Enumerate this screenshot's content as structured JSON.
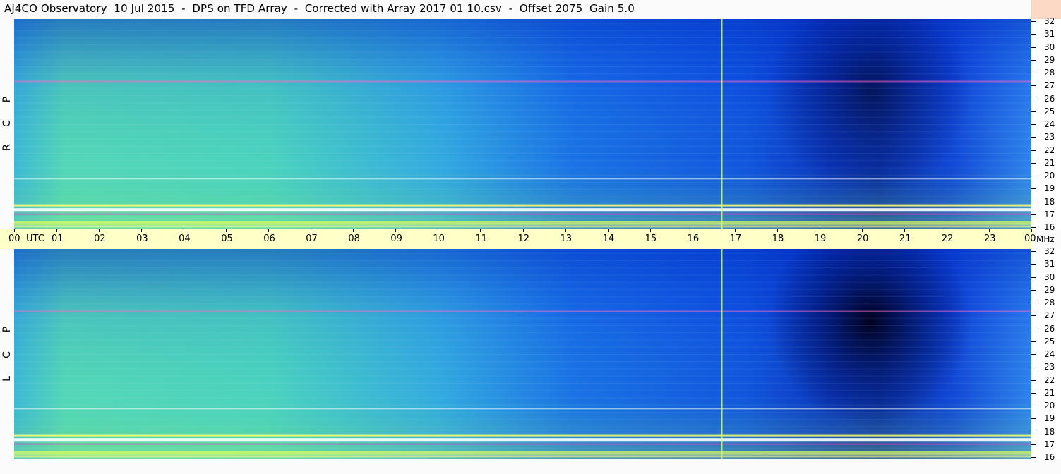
{
  "title": "AJ4CO Observatory  10 Jul 2015  -  DPS on TFD Array  -  Corrected with Array 2017 01 10.csv  -  Offset 2075  Gain 5.0",
  "chart_data": [
    {
      "type": "heatmap",
      "polarization": [
        "R",
        "C",
        "P"
      ],
      "x_ticks": [
        "00",
        "01",
        "02",
        "03",
        "04",
        "05",
        "06",
        "07",
        "08",
        "09",
        "10",
        "11",
        "12",
        "13",
        "14",
        "15",
        "16",
        "17",
        "18",
        "19",
        "20",
        "21",
        "22",
        "23",
        "00"
      ],
      "x_unit": "UTC",
      "y_ticks": [
        "32",
        "31",
        "30",
        "29",
        "28",
        "27",
        "26",
        "25",
        "24",
        "23",
        "22",
        "21",
        "20",
        "19",
        "18",
        "17",
        "16"
      ],
      "y_unit": "MHz",
      "ylim": [
        16,
        32
      ],
      "xlim": [
        0,
        24
      ]
    },
    {
      "type": "heatmap",
      "polarization": [
        "L",
        "C",
        "P"
      ],
      "x_ticks": [
        "00",
        "01",
        "02",
        "03",
        "04",
        "05",
        "06",
        "07",
        "08",
        "09",
        "10",
        "11",
        "12",
        "13",
        "14",
        "15",
        "16",
        "17",
        "18",
        "19",
        "20",
        "21",
        "22",
        "23",
        "00"
      ],
      "x_unit": "UTC",
      "y_ticks": [
        "32",
        "31",
        "30",
        "29",
        "28",
        "27",
        "26",
        "25",
        "24",
        "23",
        "22",
        "21",
        "20",
        "19",
        "18",
        "17",
        "16"
      ],
      "y_unit": "MHz",
      "ylim": [
        16,
        32
      ],
      "xlim": [
        0,
        24
      ]
    }
  ],
  "axis_labels": {
    "utc": "UTC",
    "mhz": "MHz"
  }
}
